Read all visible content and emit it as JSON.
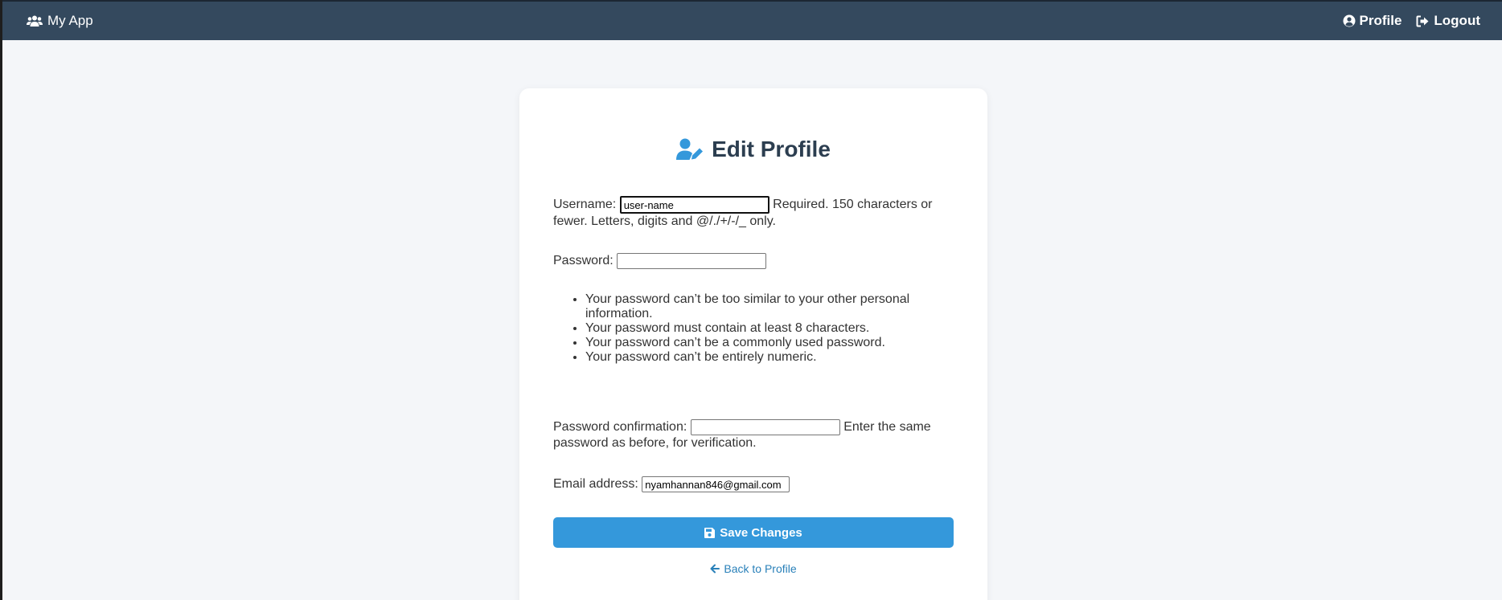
{
  "header": {
    "brand": "My App",
    "profile_link": "Profile",
    "logout_link": "Logout",
    "bg_color": "#34495e"
  },
  "form": {
    "title": "Edit Profile",
    "username": {
      "label": "Username:",
      "value": "user-name",
      "help": "Required. 150 characters or fewer. Letters, digits and @/./+/-/_ only."
    },
    "password": {
      "label": "Password:",
      "value": "",
      "rules": [
        "Your password can’t be too similar to your other personal information.",
        "Your password must contain at least 8 characters.",
        "Your password can’t be a commonly used password.",
        "Your password can’t be entirely numeric."
      ]
    },
    "password_confirmation": {
      "label": "Password confirmation:",
      "value": "",
      "help": "Enter the same password as before, for verification."
    },
    "email": {
      "label": "Email address:",
      "value": "nyamhannan846@gmail.com"
    },
    "save_button": "Save Changes",
    "back_link": "Back to Profile",
    "accent_color": "#3498db"
  },
  "icons": {
    "brand": "users-icon",
    "profile": "user-circle-icon",
    "logout": "sign-out-icon",
    "title": "user-edit-icon",
    "save": "floppy-disk-icon",
    "back": "arrow-left-icon"
  }
}
